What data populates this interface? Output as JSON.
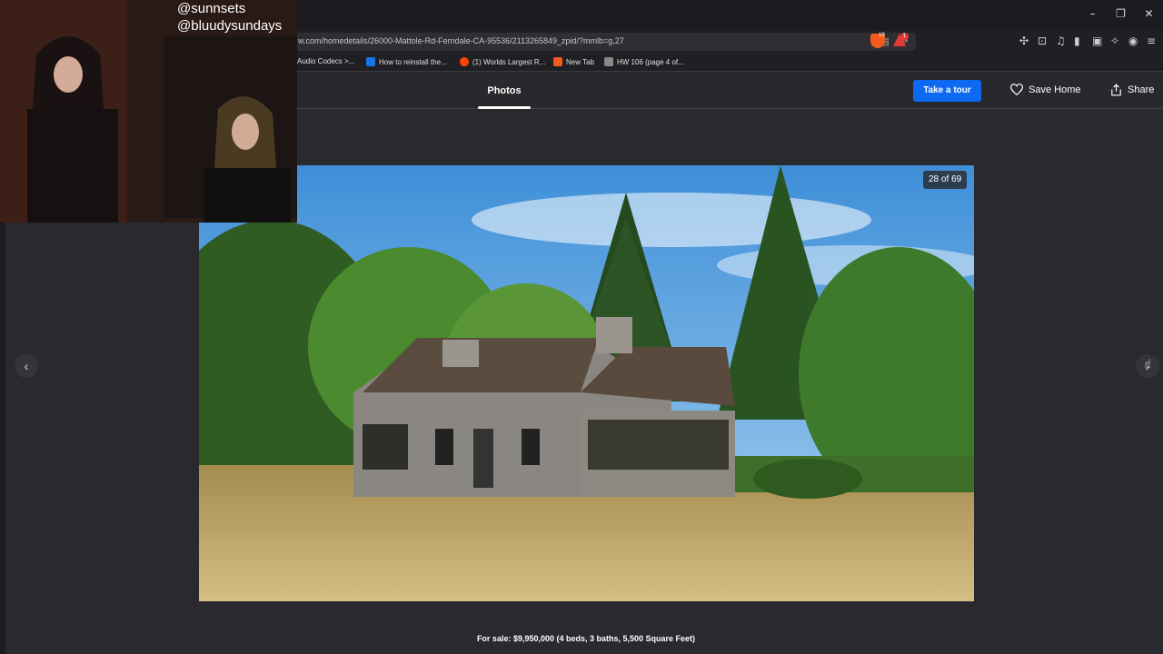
{
  "browser": {
    "url": "w.com/homedetails/26000-Mattole-Rd-Ferndale-CA-95536/2113265849_zpid/?mmlb=g,27",
    "shield_count": "19",
    "alert_badge": "1",
    "window_controls": [
      "–",
      "❐",
      "✕"
    ],
    "bookmarks": [
      {
        "label": "Audio Codecs >...",
        "icon_color": "#333333"
      },
      {
        "label": "How to reinstall the...",
        "icon_color": "#1a73e8"
      },
      {
        "label": "(1) Worlds Largest R...",
        "icon_color": "#ff4500"
      },
      {
        "label": "New Tab",
        "icon_color": "#f25a1e"
      },
      {
        "label": "HW 106 (page 4 of...",
        "icon_color": "#888888"
      }
    ]
  },
  "header": {
    "tab_photos": "Photos",
    "tour_button": "Take a tour",
    "save_home": "Save Home",
    "share": "Share",
    "accent_color": "#0d69f2"
  },
  "gallery": {
    "counter": "28 of 69",
    "caption": "For sale: $9,950,000 (4 beds, 3 baths, 5,500 Square Feet)",
    "prev_icon": "‹",
    "next_icon": "›"
  },
  "webcam": {
    "handle1": "@sunnsets",
    "handle2": "@bluudysundays"
  }
}
